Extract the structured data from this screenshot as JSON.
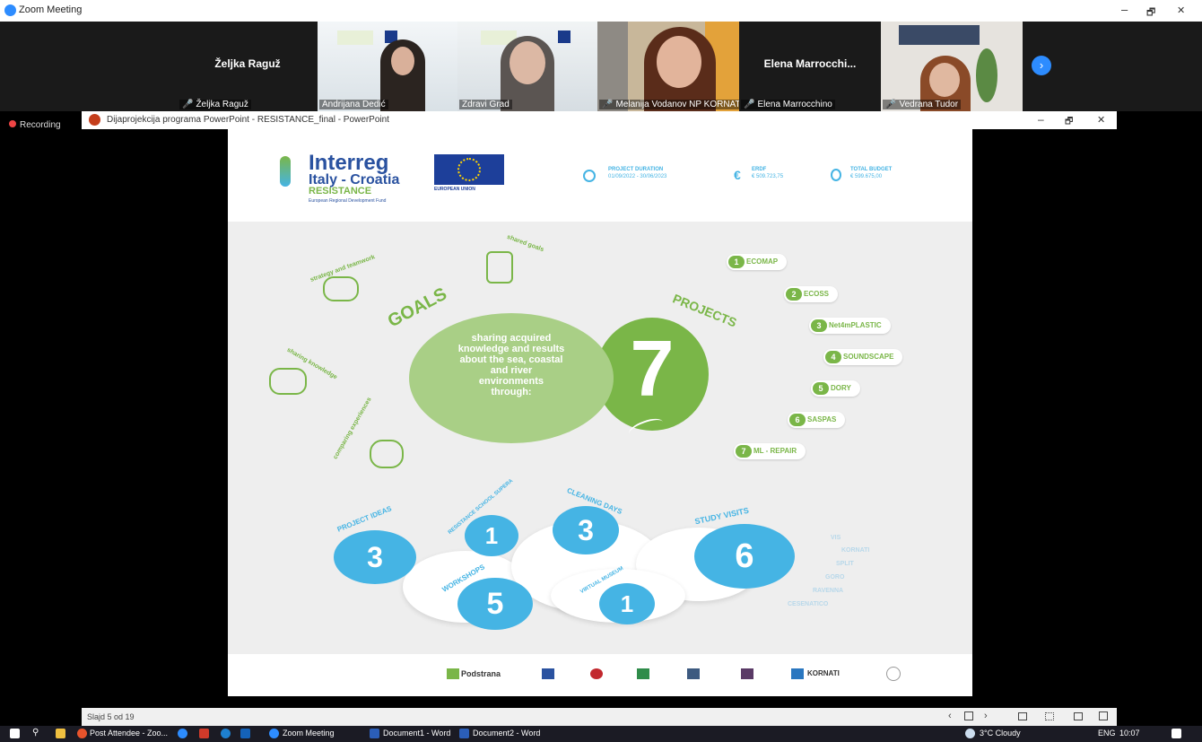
{
  "zoom": {
    "title": "Zoom Meeting",
    "recording": "Recording",
    "win_min": "–",
    "win_max": "🗗",
    "win_close": "✕"
  },
  "participants": [
    {
      "name": "Željka Raguž",
      "label": "Željka Raguž",
      "video": false
    },
    {
      "name": "Andrijana Dedić",
      "video": true
    },
    {
      "name": "Zdravi Grad",
      "video": true
    },
    {
      "name": "Melanija Vodanov NP KORNATI",
      "video": true
    },
    {
      "name": "Elena Marrocchino",
      "label": "Elena Marrocchi...",
      "video": false
    },
    {
      "name": "Vedrana Tudor",
      "video": true
    }
  ],
  "ppt": {
    "window_title": "Dijaprojekcija programa PowerPoint  -  RESISTANCE_final - PowerPoint",
    "status": "Slajd 5 od 19"
  },
  "slide": {
    "brand_title": "Interreg",
    "brand_sub": "Italy - Croatia",
    "brand_project": "RESISTANCE",
    "brand_fund": "European Regional Development Fund",
    "eu_label": "EUROPEAN UNION",
    "duration_label": "PROJECT DURATION",
    "duration_value": "01/09/2022 - 30/06/2023",
    "erdf_label": "ERDF",
    "erdf_value": "€ 509.723,75",
    "budget_label": "TOTAL BUDGET",
    "budget_value": "€ 599.675,00",
    "goals_word": "GOALS",
    "projects_word": "PROJECTS",
    "center_text": "sharing acquired knowledge and results about the sea, coastal and river environments through:",
    "projects_count": "7",
    "goals": [
      "shared goals",
      "strategy and teamwork",
      "sharing knowledge",
      "comparing experiences"
    ],
    "projects": [
      {
        "n": "1",
        "name": "ECOMAP"
      },
      {
        "n": "2",
        "name": "ECOSS"
      },
      {
        "n": "3",
        "name": "Net4mPLASTIC"
      },
      {
        "n": "4",
        "name": "SOUNDSCAPE"
      },
      {
        "n": "5",
        "name": "DORY"
      },
      {
        "n": "6",
        "name": "SASPAS"
      },
      {
        "n": "7",
        "name": "ML - REPAIR"
      }
    ],
    "activities": {
      "project_ideas": {
        "label": "PROJECT IDEAS",
        "n": "3"
      },
      "school": {
        "label": "RESISTANCE SCHOOL SUPERA",
        "n": "1"
      },
      "cleaning": {
        "label": "CLEANING DAYS",
        "n": "3"
      },
      "workshops": {
        "label": "WORKSHOPS",
        "n": "5"
      },
      "museum": {
        "label": "VIRTUAL MUSEUM",
        "n": "1"
      },
      "study": {
        "label": "STUDY VISITS",
        "n": "6"
      }
    },
    "visits": [
      "VIS",
      "KORNATI",
      "SPLIT",
      "GORO",
      "RAVENNA",
      "CESENATICO"
    ],
    "partners": [
      "Podstrana",
      "KORNATI"
    ]
  },
  "taskbar": {
    "items": [
      "Post Attendee - Zoo...",
      "Zoom Meeting",
      "Document1 - Word",
      "Document2 - Word"
    ],
    "weather": "3°C  Cloudy",
    "lang": "ENG",
    "time": "10:07"
  }
}
